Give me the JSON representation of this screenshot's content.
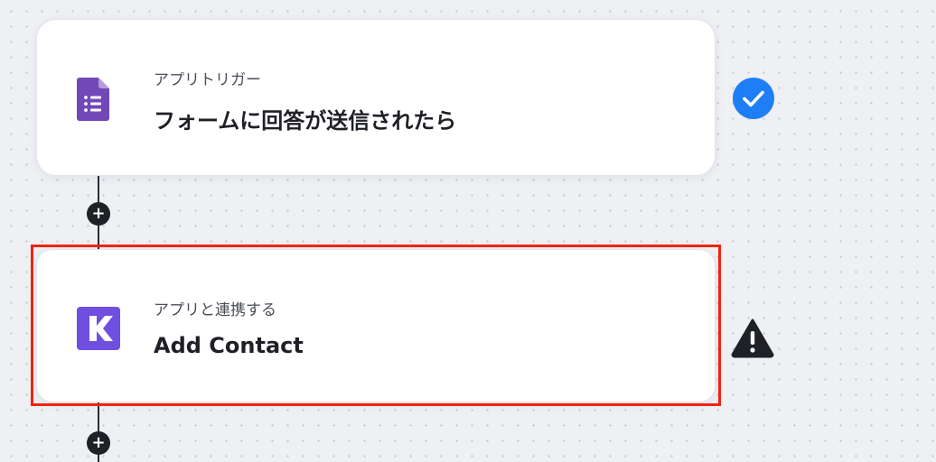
{
  "flow": {
    "trigger": {
      "label": "アプリトリガー",
      "title": "フォームに回答が送信されたら",
      "app_icon": "google-forms-icon",
      "app_color": "#7248b9",
      "status": "completed",
      "status_icon": "check-circle-icon",
      "status_color": "#1e7ef5"
    },
    "action": {
      "label": "アプリと連携する",
      "title": "Add Contact",
      "app_icon": "kit-app-icon",
      "app_color": "#6f4fe0",
      "status": "warning",
      "status_icon": "warning-triangle-icon",
      "status_color": "#1f2126",
      "highlight_color": "#f0240f"
    },
    "add_step_buttons": [
      {
        "label": "+"
      },
      {
        "label": "+"
      }
    ]
  }
}
